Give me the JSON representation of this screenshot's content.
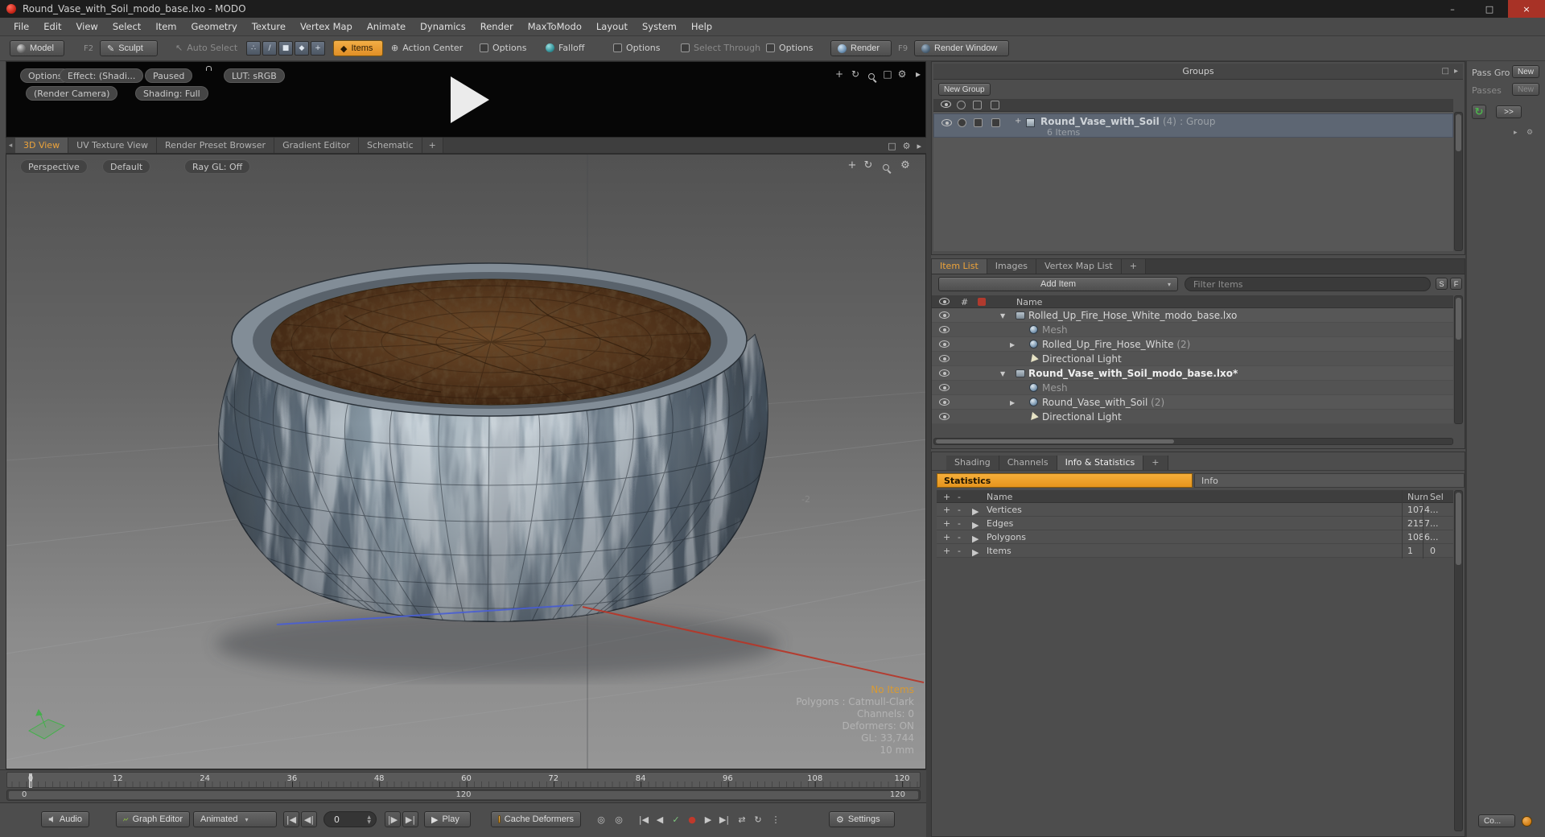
{
  "window": {
    "title": "Round_Vase_with_Soil_modo_base.lxo - MODO"
  },
  "menubar": {
    "items": [
      "File",
      "Edit",
      "View",
      "Select",
      "Item",
      "Geometry",
      "Texture",
      "Vertex Map",
      "Animate",
      "Dynamics",
      "Render",
      "MaxToModo",
      "Layout",
      "System",
      "Help"
    ]
  },
  "toolbar": {
    "model": "Model",
    "model_shortcut": "F2",
    "sculpt": "Sculpt",
    "auto_select": "Auto Select",
    "items_mode": "Items",
    "action_center": "Action Center",
    "options_a": "Options",
    "falloff": "Falloff",
    "options_b": "Options",
    "select_through": "Select Through",
    "options_c": "Options",
    "render": "Render",
    "render_shortcut": "F9",
    "render_window": "Render Window"
  },
  "preview": {
    "options": "Options",
    "effect": "Effect: (Shadi...",
    "paused": "Paused",
    "lut": "LUT: sRGB",
    "render_camera": "(Render Camera)",
    "shading": "Shading: Full"
  },
  "viewport": {
    "tabs": [
      "3D View",
      "UV Texture View",
      "Render Preset Browser",
      "Gradient Editor",
      "Schematic"
    ],
    "add_tab": "+",
    "perspective": "Perspective",
    "style": "Default",
    "raygl": "Ray GL: Off",
    "grid_label": "-2",
    "info": {
      "no_items": "No Items",
      "lines": [
        "Polygons : Catmull-Clark",
        "Channels: 0",
        "Deformers: ON",
        "GL: 33,744",
        "10 mm"
      ]
    }
  },
  "timeline": {
    "ticks": [
      "0",
      "12",
      "24",
      "36",
      "48",
      "60",
      "72",
      "84",
      "96",
      "108",
      "120"
    ],
    "range_start": "0",
    "range_mid": "120",
    "range_end": "120"
  },
  "transport": {
    "audio": "Audio",
    "graph_editor": "Graph Editor",
    "animated": "Animated",
    "frame": "0",
    "play": "Play",
    "cache_deformers": "Cache Deformers",
    "settings": "Settings"
  },
  "groups": {
    "title": "Groups",
    "new_group": "New Group",
    "row": {
      "name": "Round_Vase_with_Soil",
      "count": "(4)",
      "suffix": ": Group",
      "items": "6 Items"
    }
  },
  "passes": {
    "pass_groups": "Pass Gro",
    "new_group_btn": "New",
    "passes": "Passes",
    "new_pass_btn": "New",
    "expand": ">>"
  },
  "item_list": {
    "tabs": [
      "Item List",
      "Images",
      "Vertex Map List"
    ],
    "add_tab": "+",
    "add_item": "Add Item",
    "filter_placeholder": "Filter Items",
    "s_label": "S",
    "f_label": "F",
    "num_col": "#",
    "name_col": "Name",
    "rows": [
      {
        "name": "Rolled_Up_Fire_Hose_White_modo_base.lxo",
        "count": "",
        "icon": "scene",
        "indent": 1,
        "arrow": "▼",
        "dim": false,
        "bold": false
      },
      {
        "name": "Mesh",
        "count": "",
        "icon": "mesh",
        "indent": 2,
        "arrow": "",
        "dim": true,
        "bold": false
      },
      {
        "name": "Rolled_Up_Fire_Hose_White",
        "count": "(2)",
        "icon": "mesh",
        "indent": 2,
        "arrow": "▶",
        "dim": false,
        "bold": false
      },
      {
        "name": "Directional Light",
        "count": "",
        "icon": "light",
        "indent": 2,
        "arrow": "",
        "dim": false,
        "bold": false
      },
      {
        "name": "Round_Vase_with_Soil_modo_base.lxo*",
        "count": "",
        "icon": "scene",
        "indent": 1,
        "arrow": "▼",
        "dim": false,
        "bold": true
      },
      {
        "name": "Mesh",
        "count": "",
        "icon": "mesh",
        "indent": 2,
        "arrow": "",
        "dim": true,
        "bold": false
      },
      {
        "name": "Round_Vase_with_Soil",
        "count": "(2)",
        "icon": "mesh",
        "indent": 2,
        "arrow": "▶",
        "dim": false,
        "bold": false
      },
      {
        "name": "Directional Light",
        "count": "",
        "icon": "light",
        "indent": 2,
        "arrow": "",
        "dim": false,
        "bold": false
      }
    ]
  },
  "stats": {
    "tabs": [
      "Shading",
      "Channels",
      "Info & Statistics"
    ],
    "add_tab": "+",
    "subtab_statistics": "Statistics",
    "subtab_info": "Info",
    "columns": {
      "name": "Name",
      "num": "Num",
      "sel": "Sel"
    },
    "rows": [
      {
        "name": "Vertices",
        "num": "1074",
        "sel": "..."
      },
      {
        "name": "Edges",
        "num": "2157",
        "sel": "..."
      },
      {
        "name": "Polygons",
        "num": "1086",
        "sel": "..."
      },
      {
        "name": "Items",
        "num": "1",
        "sel": "0"
      }
    ]
  },
  "misc": {
    "co": "Co..."
  },
  "colors": {
    "accent": "#eda33a",
    "statistics_bar": "#ee9b22",
    "blue_axis": "#4a5fd4",
    "red_axis": "#b83527"
  }
}
